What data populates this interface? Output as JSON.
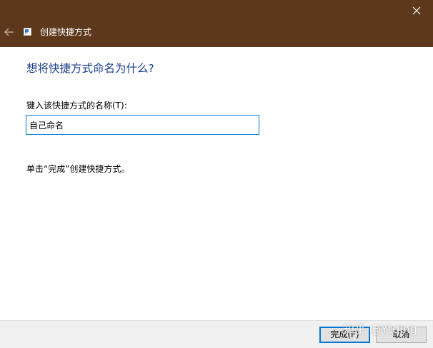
{
  "window": {
    "title": "创建快捷方式",
    "titlebar_color": "#5e381b"
  },
  "icons": {
    "back": "back-arrow-icon",
    "close": "close-icon",
    "app": "shortcut-icon"
  },
  "main": {
    "heading": "想将快捷方式命名为什么?",
    "name_label": "键入该快捷方式的名称(T):",
    "name_value": "自己命名",
    "hint": "单击“完成”创建快捷方式。"
  },
  "footer": {
    "finish_label": "完成(F)",
    "cancel_label": "取消"
  },
  "watermark": "知乎 @Ytqing",
  "colors": {
    "accent": "#0078d7",
    "heading": "#1a3d8f",
    "footer_bg": "#f0f0f0"
  }
}
